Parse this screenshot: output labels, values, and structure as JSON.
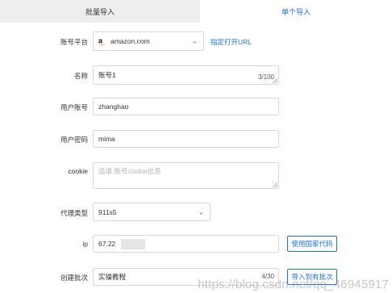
{
  "tabs": [
    {
      "label": "批量导入"
    },
    {
      "label": "单个导入"
    }
  ],
  "form": {
    "platform": {
      "label": "账号平台",
      "value": "amazon.com",
      "link": "指定打开URL"
    },
    "name": {
      "label": "名称",
      "value": "账号1",
      "count": "3/100"
    },
    "username": {
      "label": "用户账号",
      "value": "zhanghao"
    },
    "password": {
      "label": "用户密码",
      "value": "mima"
    },
    "cookie": {
      "label": "cookie",
      "placeholder": "选填:账号cookie信息"
    },
    "proxy": {
      "label": "代理类型",
      "value": "911s5"
    },
    "ip": {
      "label": "ip",
      "value": "67.22",
      "button": "使用国家代码"
    },
    "batch": {
      "label": "创建批次",
      "value": "实操教程",
      "count": "4/30",
      "button": "导入到有批次"
    }
  },
  "watermark": "https://blog.csdn.net/qq_46945917",
  "icons": {
    "platform_logo": "amazon-logo-icon",
    "dropdown": "chevron-down-icon"
  }
}
